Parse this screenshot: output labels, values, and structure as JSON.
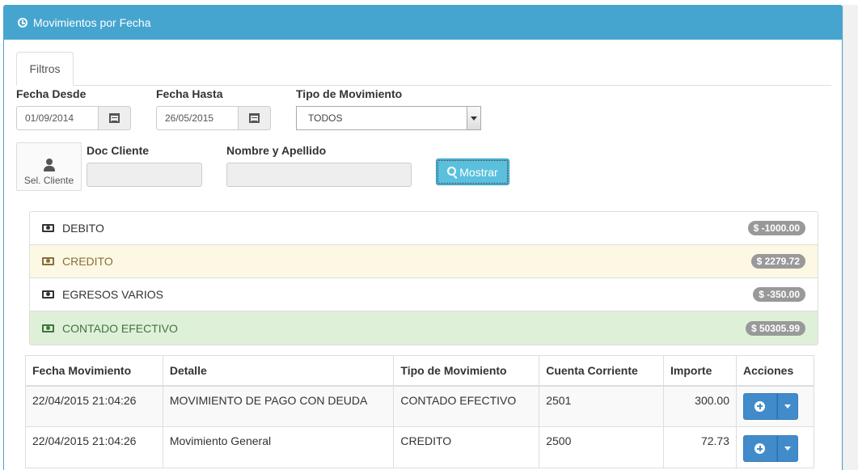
{
  "panel": {
    "title": "Movimientos por Fecha",
    "icon": "clock-icon"
  },
  "tabs": [
    {
      "label": "Filtros"
    }
  ],
  "filters": {
    "fecha_desde_label": "Fecha Desde",
    "fecha_desde_value": "01/09/2014",
    "fecha_hasta_label": "Fecha Hasta",
    "fecha_hasta_value": "26/05/2015",
    "tipo_label": "Tipo de Movimiento",
    "tipo_value": "TODOS",
    "sel_cliente_label": "Sel. Cliente",
    "doc_cliente_label": "Doc Cliente",
    "doc_cliente_value": "",
    "nombre_label": "Nombre y Apellido",
    "nombre_value": "",
    "mostrar_label": "Mostrar"
  },
  "summary": [
    {
      "label": "DEBITO",
      "amount": "$ -1000.00",
      "style": "default"
    },
    {
      "label": "CREDITO",
      "amount": "$ 2279.72",
      "style": "warning"
    },
    {
      "label": "EGRESOS VARIOS",
      "amount": "$ -350.00",
      "style": "default"
    },
    {
      "label": "CONTADO EFECTIVO",
      "amount": "$ 50305.99",
      "style": "success"
    }
  ],
  "table": {
    "headers": [
      "Fecha Movimiento",
      "Detalle",
      "Tipo de Movimiento",
      "Cuenta Corriente",
      "Importe",
      "Acciones"
    ],
    "rows": [
      [
        "22/04/2015 21:04:26",
        "MOVIMIENTO DE PAGO CON DEUDA",
        "CONTADO EFECTIVO",
        "2501",
        "300.00"
      ],
      [
        "22/04/2015 21:04:26",
        "Movimiento General",
        "CREDITO",
        "2500",
        "72.73"
      ]
    ]
  },
  "colors": {
    "header": "#45a5cf",
    "primary": "#428bca",
    "info": "#5bc0de",
    "warning_bg": "#fcf8e3",
    "success_bg": "#dff0d8"
  }
}
